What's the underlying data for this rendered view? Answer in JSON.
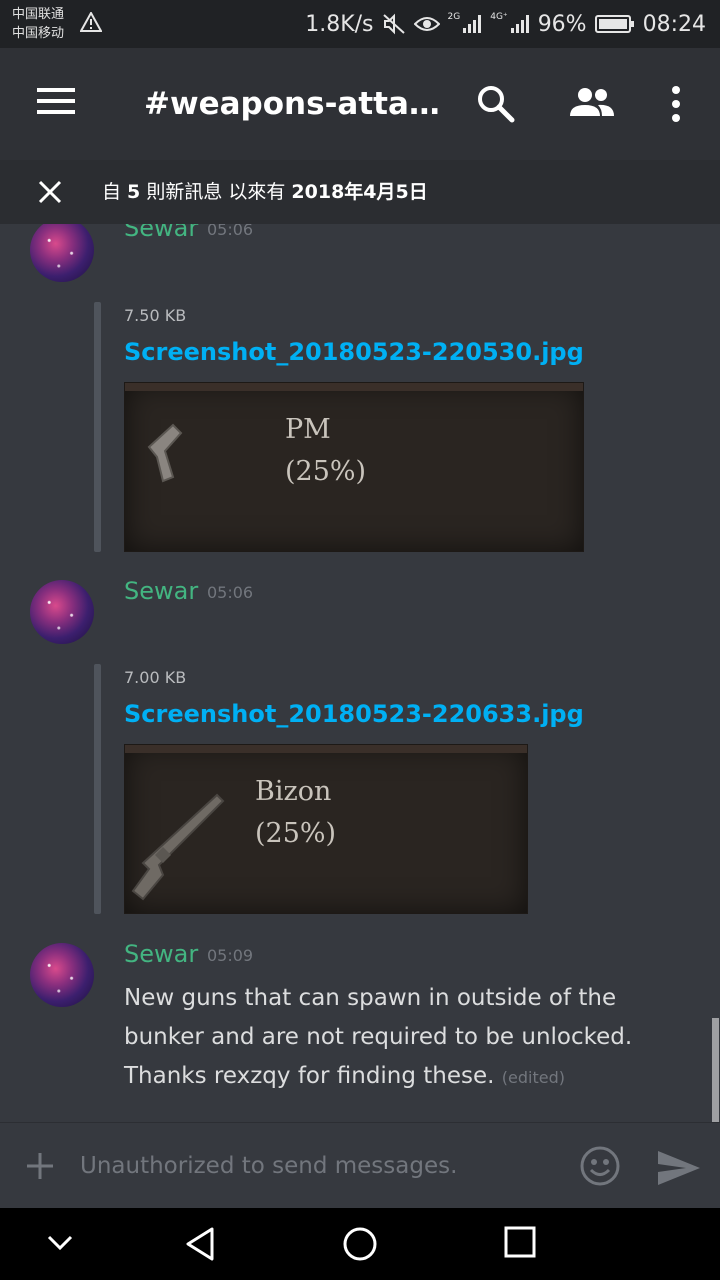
{
  "status_bar": {
    "carrier_1": "中国联通",
    "carrier_2": "中国移动",
    "speed": "1.8K/s",
    "net_1": "2G",
    "net_2": "4G⁺",
    "battery": "96%",
    "time": "08:24"
  },
  "app_bar": {
    "title": "#weapons-attach..."
  },
  "new_messages_bar": {
    "prefix": "自 ",
    "count": "5",
    "middle": " 則新訊息 以來有 ",
    "date": "2018年4月5日"
  },
  "messages": [
    {
      "author": "Sewar",
      "time": "05:06",
      "attachment": {
        "size": "7.50 KB",
        "filename": "Screenshot_20180523-220530.jpg",
        "caption_line_1": "PM",
        "caption_line_2": "(25%)"
      }
    },
    {
      "author": "Sewar",
      "time": "05:06",
      "attachment": {
        "size": "7.00 KB",
        "filename": "Screenshot_20180523-220633.jpg",
        "caption_line_1": "Bizon",
        "caption_line_2": "(25%)"
      }
    },
    {
      "author": "Sewar",
      "time": "05:09",
      "text_line_1": "New guns that can spawn in outside of the",
      "text_line_2": "bunker and are not required to be unlocked.",
      "text_line_3": "Thanks rexzqy for finding these.",
      "edited": "(edited)"
    }
  ],
  "input": {
    "placeholder": "Unauthorized to send messages."
  },
  "colors": {
    "background": "#36393f",
    "appbar": "#2f3136",
    "author": "#43b581",
    "link": "#00b0f4"
  }
}
